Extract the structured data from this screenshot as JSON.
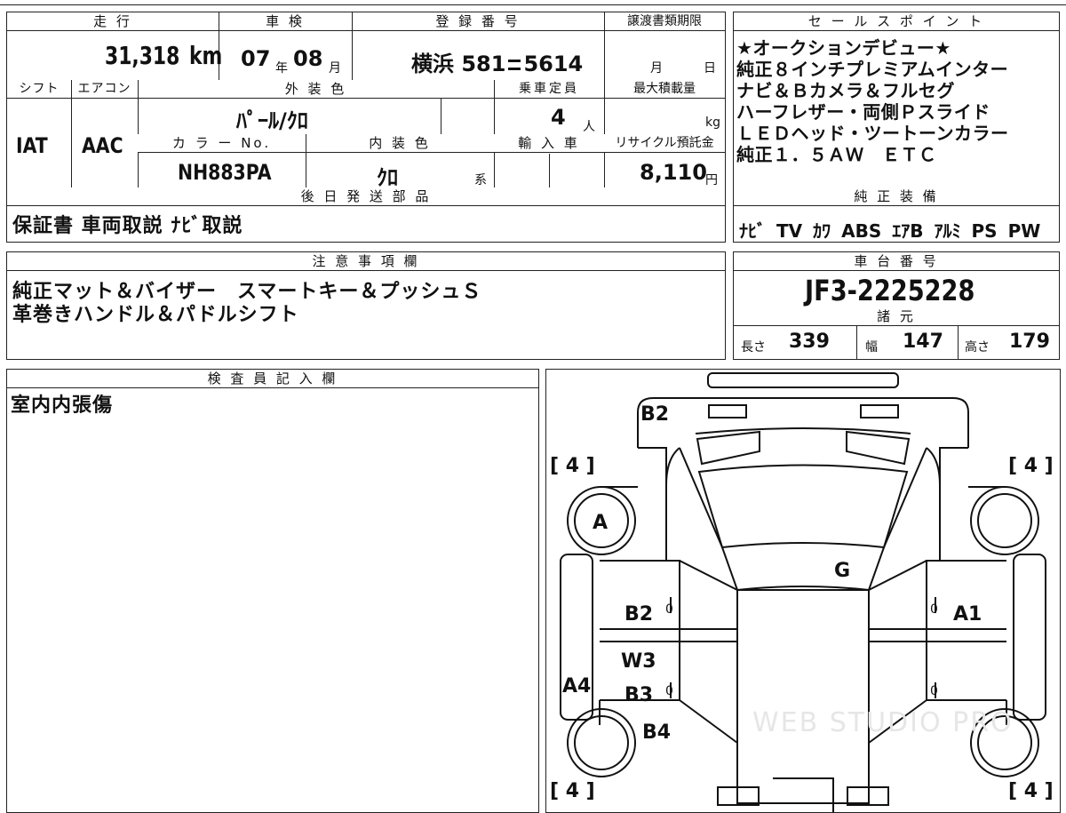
{
  "top": {
    "h_mileage": "走 行",
    "h_inspection": "車 検",
    "h_registration": "登 録 番 号",
    "h_transfer_deadline": "譲渡書類期限",
    "h_sales_point": "セ ー ル ス ポ イ ン ト",
    "mileage": "31,318",
    "mileage_unit": "km",
    "insp_year": "07",
    "insp_year_unit": "年",
    "insp_month": "08",
    "insp_month_unit": "月",
    "registration": "横浜 581",
    "registration_num": "5614",
    "deadline_month_unit": "月",
    "deadline_day_unit": "日"
  },
  "spec": {
    "h_shift": "シフト",
    "h_aircon": "エアコン",
    "h_exterior_color": "外 装 色",
    "h_capacity": "乗車定員",
    "h_max_load": "最大積載量",
    "shift": "IAT",
    "aircon": "AAC",
    "exterior_color": "ﾊﾟｰﾙ/ｸﾛ",
    "capacity": "4",
    "capacity_unit": "人",
    "load_unit": "kg",
    "h_color_no": "カ ラ ー No.",
    "h_interior_color": "内 装 色",
    "h_import": "輸 入 車",
    "h_recycle": "リサイクル預託金",
    "color_no": "NH883PA",
    "interior_color": "ｸﾛ",
    "interior_suffix": "系",
    "recycle": "8,110",
    "recycle_unit": "円"
  },
  "sales_points": [
    "★オークションデビュー★",
    "純正８インチプレミアムインター",
    "ナビ＆Ｂカメラ＆フルセグ",
    "ハーフレザー・両側Ｐスライド",
    "ＬＥＤヘッド・ツートーンカラー",
    "純正１．５ＡＷ　ＥＴＣ"
  ],
  "delivery": {
    "header": "後 日 発 送 部 品",
    "text": "保証書 車両取説 ﾅﾋﾞ取説"
  },
  "equipment": {
    "header": "純 正 装 備",
    "items": [
      "ﾅﾋﾞ",
      "TV",
      "ｶﾜ",
      "ABS",
      "ｴｱB",
      "ｱﾙﾐ",
      "PS",
      "PW"
    ]
  },
  "notes": {
    "header": "注 意 事 項 欄",
    "lines": [
      "純正マット＆バイザー　スマートキー＆プッシュＳ",
      "革巻きハンドル＆パドルシフト"
    ]
  },
  "chassis": {
    "header": "車 台 番 号",
    "value": "JF3-2225228"
  },
  "dims": {
    "header": "諸 元",
    "length_label": "長さ",
    "length": "339",
    "width_label": "幅",
    "width": "147",
    "height_label": "高さ",
    "height": "179"
  },
  "inspector": {
    "header": "検 査 員 記 入 欄",
    "text": "室内内張傷"
  },
  "diagram": {
    "tire_fl": "[ 4 ]",
    "tire_fr": "[ 4 ]",
    "tire_rl": "[ 4 ]",
    "tire_rr": "[ 4 ]",
    "mark_a": "A",
    "mark_b2_top": "B2",
    "mark_g": "G",
    "mark_b2": "B2",
    "mark_a1": "A1",
    "mark_w3": "W3",
    "mark_a4": "A4",
    "mark_b3": "B3",
    "mark_b4": "B4",
    "zero": "0",
    "watermark": "WEB STUDIO PRO"
  }
}
